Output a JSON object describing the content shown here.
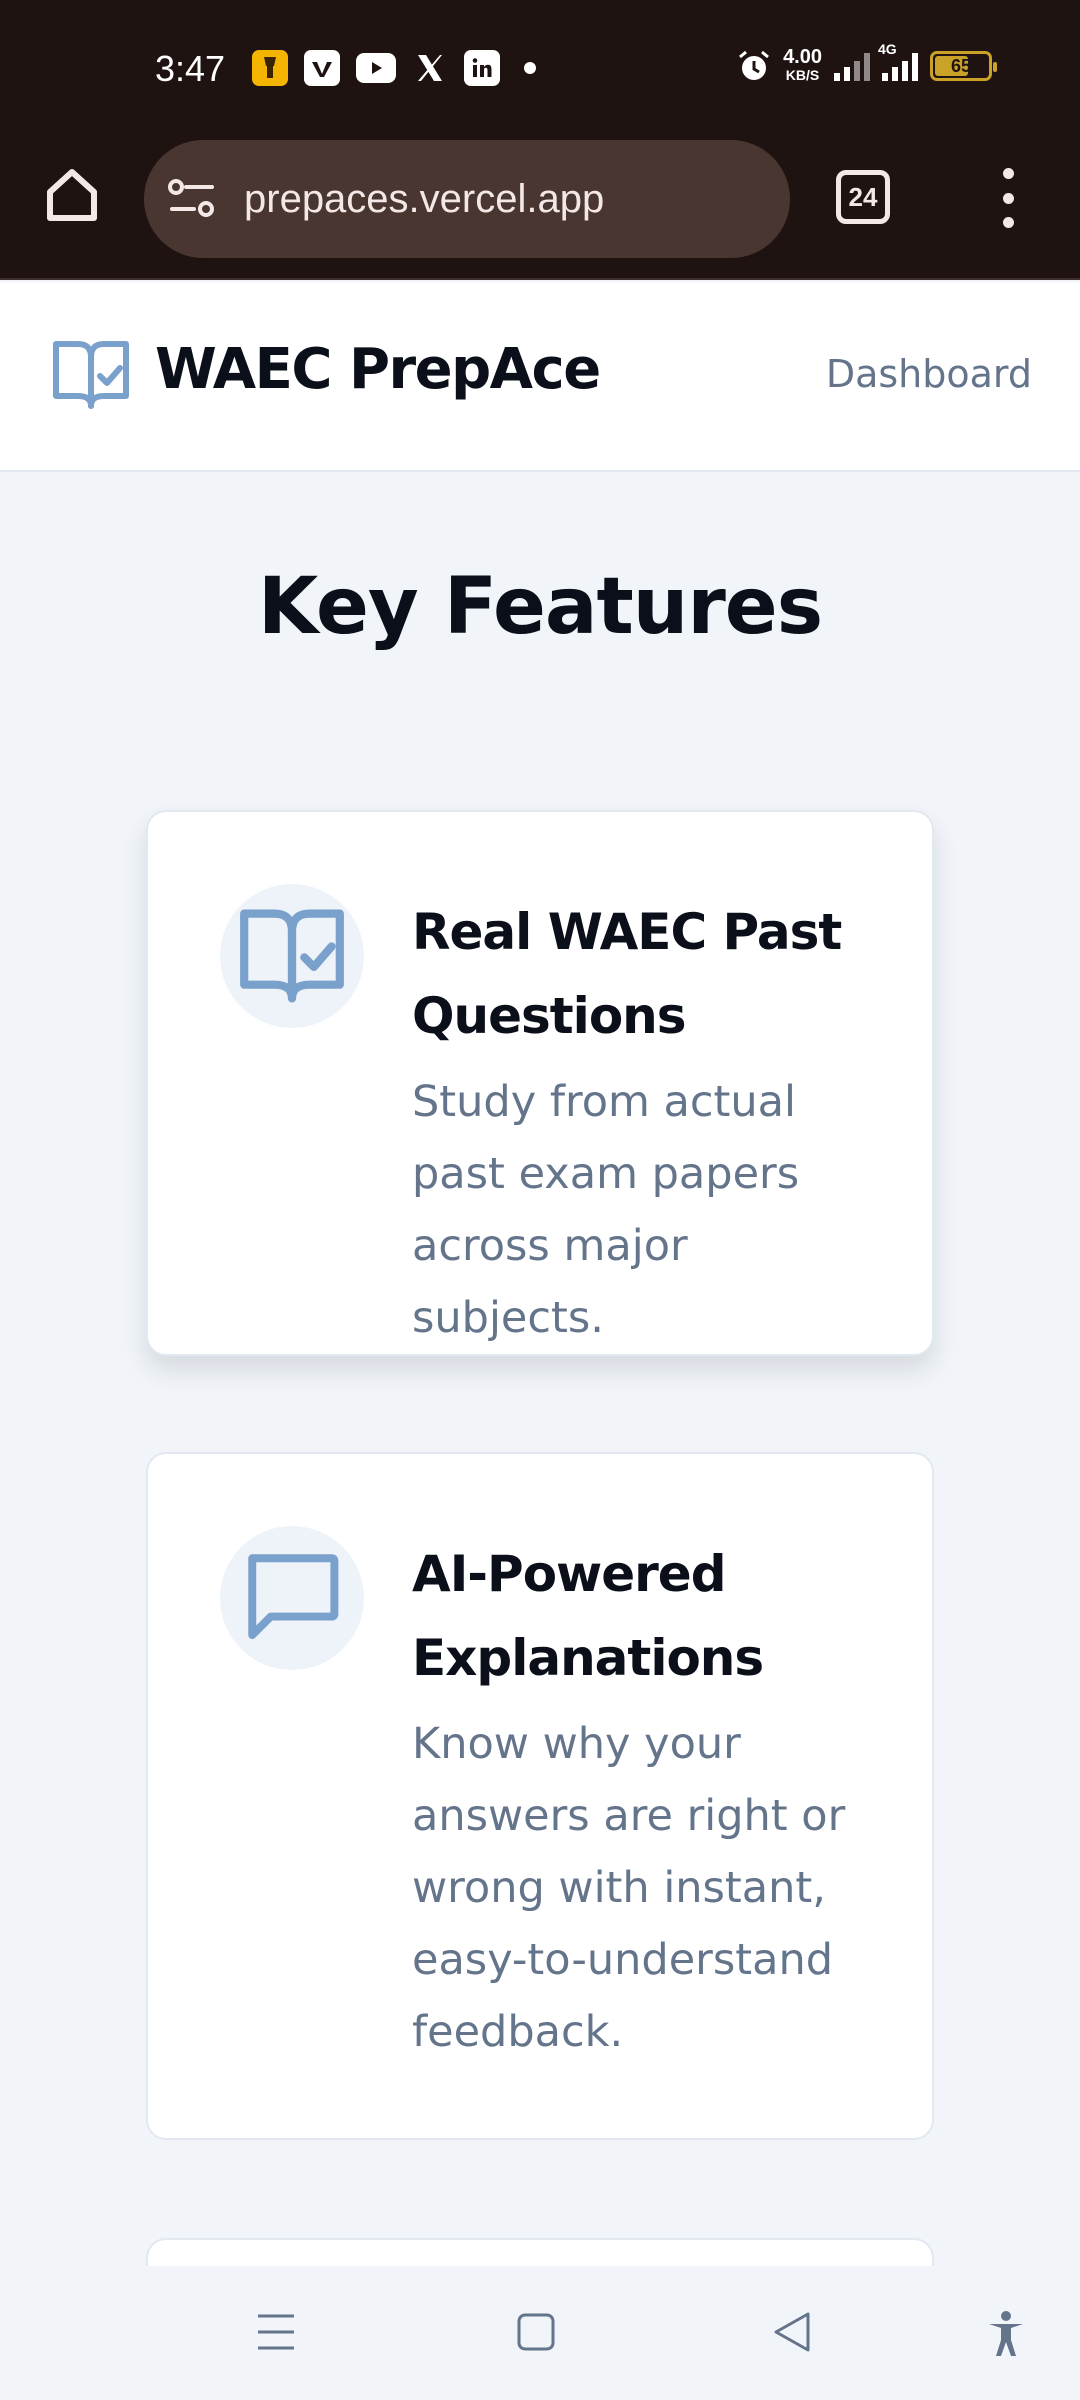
{
  "status_bar": {
    "time": "3:47",
    "notification_icons": [
      "flashlight-app-icon",
      "vimeo-icon",
      "youtube-icon",
      "x-icon",
      "linkedin-icon",
      "more-dot-icon"
    ],
    "net_speed_value": "4.00",
    "net_speed_unit": "KB/S",
    "network_type": "4G",
    "battery_level": "65",
    "battery_color": "#c9a227"
  },
  "browser": {
    "url": "prepaces.vercel.app",
    "tab_count": "24"
  },
  "header": {
    "brand": "WAEC PrepAce",
    "nav_link": "Dashboard"
  },
  "main": {
    "section_title": "Key Features",
    "features": [
      {
        "icon": "book-check-icon",
        "title": "Real WAEC Past Questions",
        "description": "Study from actual past exam papers across major subjects."
      },
      {
        "icon": "message-square-icon",
        "title": "AI-Powered Explanations",
        "description": "Know why your answers are right or wrong with instant, easy-to-understand feedback."
      }
    ]
  },
  "colors": {
    "browser_chrome": "#1f1312",
    "url_pill": "#4a3631",
    "accent_icon": "#7aa0cc",
    "heading": "#0b0f1a",
    "muted_text": "#64748b",
    "page_bg": "#f1f5f9"
  },
  "bottom_nav": [
    "menu-icon",
    "home-square-icon",
    "back-triangle-icon",
    "accessibility-icon"
  ]
}
